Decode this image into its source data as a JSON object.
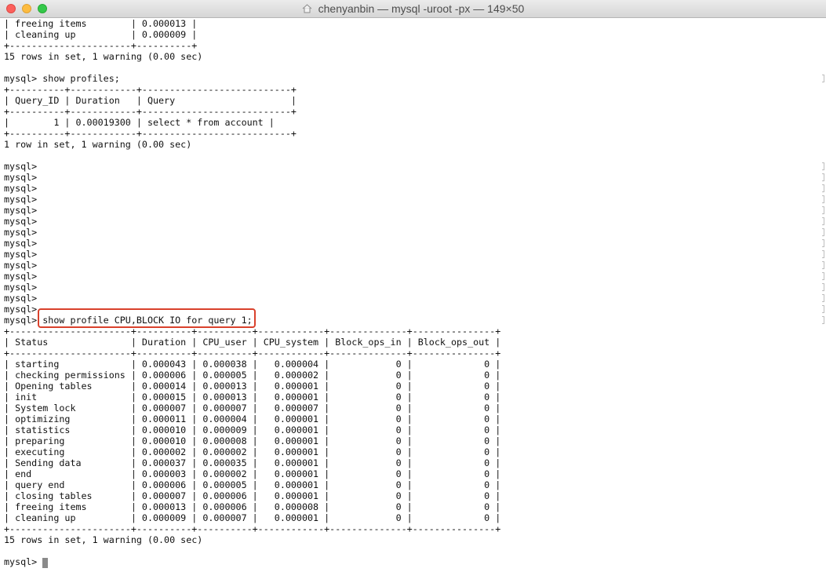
{
  "window": {
    "title": "chenyanbin — mysql -uroot -px — 149×50"
  },
  "terminal": {
    "lines": [
      "| freeing items        | 0.000013 |",
      "| cleaning up          | 0.000009 |",
      "+----------------------+----------+",
      "15 rows in set, 1 warning (0.00 sec)",
      "",
      "mysql> show profiles;",
      "+----------+------------+---------------------------+",
      "| Query_ID | Duration   | Query                     |",
      "+----------+------------+---------------------------+",
      "|        1 | 0.00019300 | select * from account |",
      "+----------+------------+---------------------------+",
      "1 row in set, 1 warning (0.00 sec)",
      "",
      "mysql>",
      "mysql>",
      "mysql>",
      "mysql>",
      "mysql>",
      "mysql>",
      "mysql>",
      "mysql>",
      "mysql>",
      "mysql>",
      "mysql>",
      "mysql>",
      "mysql>",
      "mysql>",
      "mysql> show profile CPU,BLOCK IO for query 1;",
      "+----------------------+----------+----------+------------+--------------+---------------+",
      "| Status               | Duration | CPU_user | CPU_system | Block_ops_in | Block_ops_out |",
      "+----------------------+----------+----------+------------+--------------+---------------+",
      "| starting             | 0.000043 | 0.000038 |   0.000004 |            0 |             0 |",
      "| checking permissions | 0.000006 | 0.000005 |   0.000002 |            0 |             0 |",
      "| Opening tables       | 0.000014 | 0.000013 |   0.000001 |            0 |             0 |",
      "| init                 | 0.000015 | 0.000013 |   0.000001 |            0 |             0 |",
      "| System lock          | 0.000007 | 0.000007 |   0.000007 |            0 |             0 |",
      "| optimizing           | 0.000011 | 0.000004 |   0.000001 |            0 |             0 |",
      "| statistics           | 0.000010 | 0.000009 |   0.000001 |            0 |             0 |",
      "| preparing            | 0.000010 | 0.000008 |   0.000001 |            0 |             0 |",
      "| executing            | 0.000002 | 0.000002 |   0.000001 |            0 |             0 |",
      "| Sending data         | 0.000037 | 0.000035 |   0.000001 |            0 |             0 |",
      "| end                  | 0.000003 | 0.000002 |   0.000001 |            0 |             0 |",
      "| query end            | 0.000006 | 0.000005 |   0.000001 |            0 |             0 |",
      "| closing tables       | 0.000007 | 0.000006 |   0.000001 |            0 |             0 |",
      "| freeing items        | 0.000013 | 0.000006 |   0.000008 |            0 |             0 |",
      "| cleaning up          | 0.000009 | 0.000007 |   0.000001 |            0 |             0 |",
      "+----------------------+----------+----------+------------+--------------+---------------+",
      "15 rows in set, 1 warning (0.00 sec)",
      "",
      "mysql>"
    ]
  },
  "highlight": {
    "color": "#d9412c"
  }
}
